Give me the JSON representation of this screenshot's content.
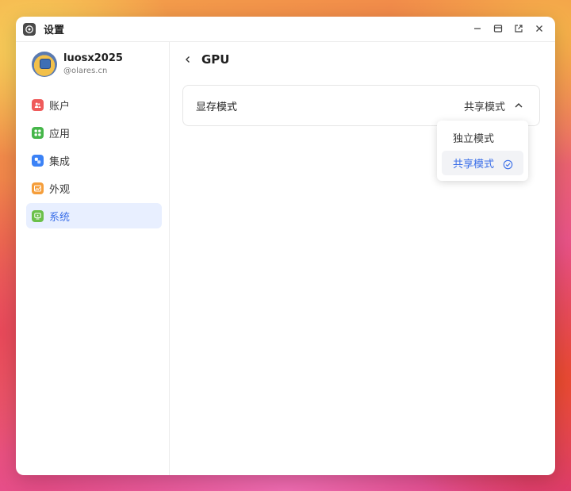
{
  "window": {
    "title": "设置",
    "icon": "settings-app-icon"
  },
  "controls": [
    "minimize-icon",
    "maximize-icon",
    "popout-icon",
    "close-icon"
  ],
  "profile": {
    "name": "luosx2025",
    "domain": "@olares.cn"
  },
  "sidebar": {
    "items": [
      {
        "label": "账户",
        "icon": "account-icon",
        "color": "#ef5b5b"
      },
      {
        "label": "应用",
        "icon": "apps-icon",
        "color": "#45b649"
      },
      {
        "label": "集成",
        "icon": "integration-icon",
        "color": "#3b82f6"
      },
      {
        "label": "外观",
        "icon": "appearance-icon",
        "color": "#f59e3b"
      },
      {
        "label": "系统",
        "icon": "system-icon",
        "color": "#6bc04a"
      }
    ],
    "active_index": 4
  },
  "page": {
    "title": "GPU",
    "back_icon": "chevron-left-icon"
  },
  "setting": {
    "label": "显存模式",
    "value": "共享模式",
    "options": [
      {
        "label": "独立模式",
        "selected": false
      },
      {
        "label": "共享模式",
        "selected": true
      }
    ]
  },
  "accent": "#3a6ee8"
}
